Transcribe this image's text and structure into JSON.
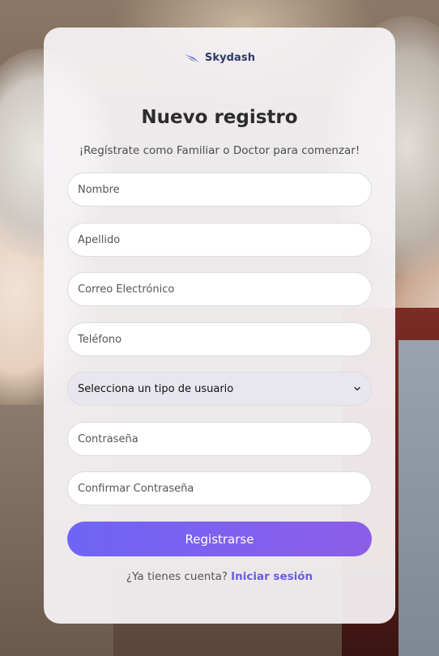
{
  "brand": {
    "name": "Skydash"
  },
  "form": {
    "title": "Nuevo registro",
    "subtitle": "¡Regístrate como Familiar o Doctor para comenzar!",
    "first_name_placeholder": "Nombre",
    "last_name_placeholder": "Apellido",
    "email_placeholder": "Correo Electrónico",
    "phone_placeholder": "Teléfono",
    "user_type_selected": "Selecciona un tipo de usuario",
    "password_placeholder": "Contraseña",
    "confirm_password_placeholder": "Confirmar Contraseña",
    "submit_label": "Registrarse",
    "login_prompt": "¿Ya tienes cuenta?",
    "login_link": "Iniciar sesión"
  },
  "colors": {
    "accent_start": "#6f64f6",
    "accent_end": "#8d5ee8",
    "link": "#6a5be6",
    "brand_text": "#2d3a66"
  },
  "icons": {
    "brand_logo": "swoosh-icon",
    "select_arrow": "chevron-down-icon"
  }
}
